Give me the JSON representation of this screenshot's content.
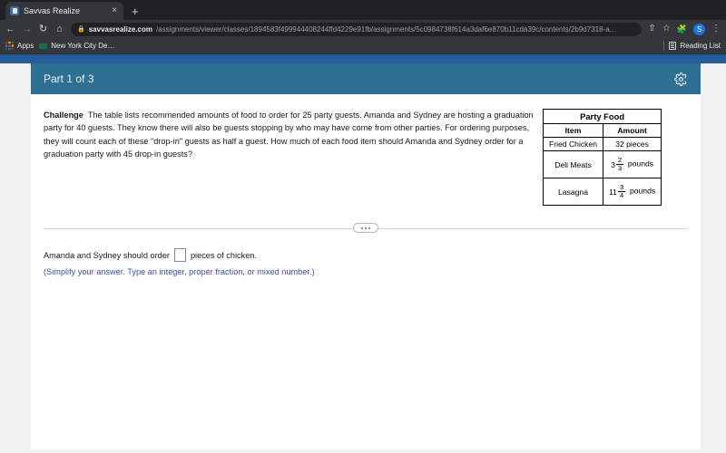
{
  "browser": {
    "tab": {
      "title": "Savvas Realize",
      "favicon": "savvas-favicon",
      "close": "×"
    },
    "new_tab_label": "+",
    "nav": {
      "back": "←",
      "forward": "→",
      "reload": "↻",
      "home": "⌂"
    },
    "omnibox": {
      "lock": "🔒",
      "host": "savvasrealize.com",
      "path": "/assignments/viewer/classes/1894583f499944408244ffd4229e91fb/assignments/5c0984738f614a3daf6e870b11cda39c/contents/2b9d7318-a…"
    },
    "toolbar_icons": {
      "share": "⇧",
      "bookmark": "☆",
      "extensions": "🧩",
      "menu": "⋮"
    },
    "profile_initial": "S",
    "bookmarks": {
      "apps": "Apps",
      "item1": "New York City De…",
      "reading_list": "Reading List"
    }
  },
  "header": {
    "part_label": "Part 1 of 3",
    "settings_icon": "gear-icon"
  },
  "question": {
    "label": "Challenge",
    "body": "The table lists recommended amounts of food to order for 25 party guests. Amanda and Sydney are hosting a graduation party for 40 guests. They know there will also be guests stopping by who may have come from other parties. For ordering purposes, they will count each of these \"drop-in\" guests as half a guest. How much of each food item should Amanda and Sydney order for a graduation party with 45 drop-in guests?"
  },
  "party_food_table": {
    "title": "Party Food",
    "columns": [
      "Item",
      "Amount"
    ],
    "rows": [
      {
        "item": "Fried Chicken",
        "amount_text": "32 pieces",
        "whole": "",
        "num": "",
        "den": "",
        "unit": ""
      },
      {
        "item": "Deli Meats",
        "amount_text": "",
        "whole": "3",
        "num": "2",
        "den": "3",
        "unit": "pounds"
      },
      {
        "item": "Lasagna",
        "amount_text": "",
        "whole": "11",
        "num": "3",
        "den": "4",
        "unit": "pounds"
      }
    ]
  },
  "divider": {
    "handle_dots": "···"
  },
  "answer": {
    "prefix": "Amanda and Sydney should order",
    "input_value": "",
    "input_placeholder": "",
    "suffix": "pieces of chicken.",
    "hint": "(Simplify your answer. Type an integer, proper fraction, or mixed number.)"
  },
  "colors": {
    "header_teal": "#2d7093",
    "top_navy": "#255d9b",
    "hint_blue": "#3b4cb8",
    "page_gray": "#f1f1f1"
  }
}
